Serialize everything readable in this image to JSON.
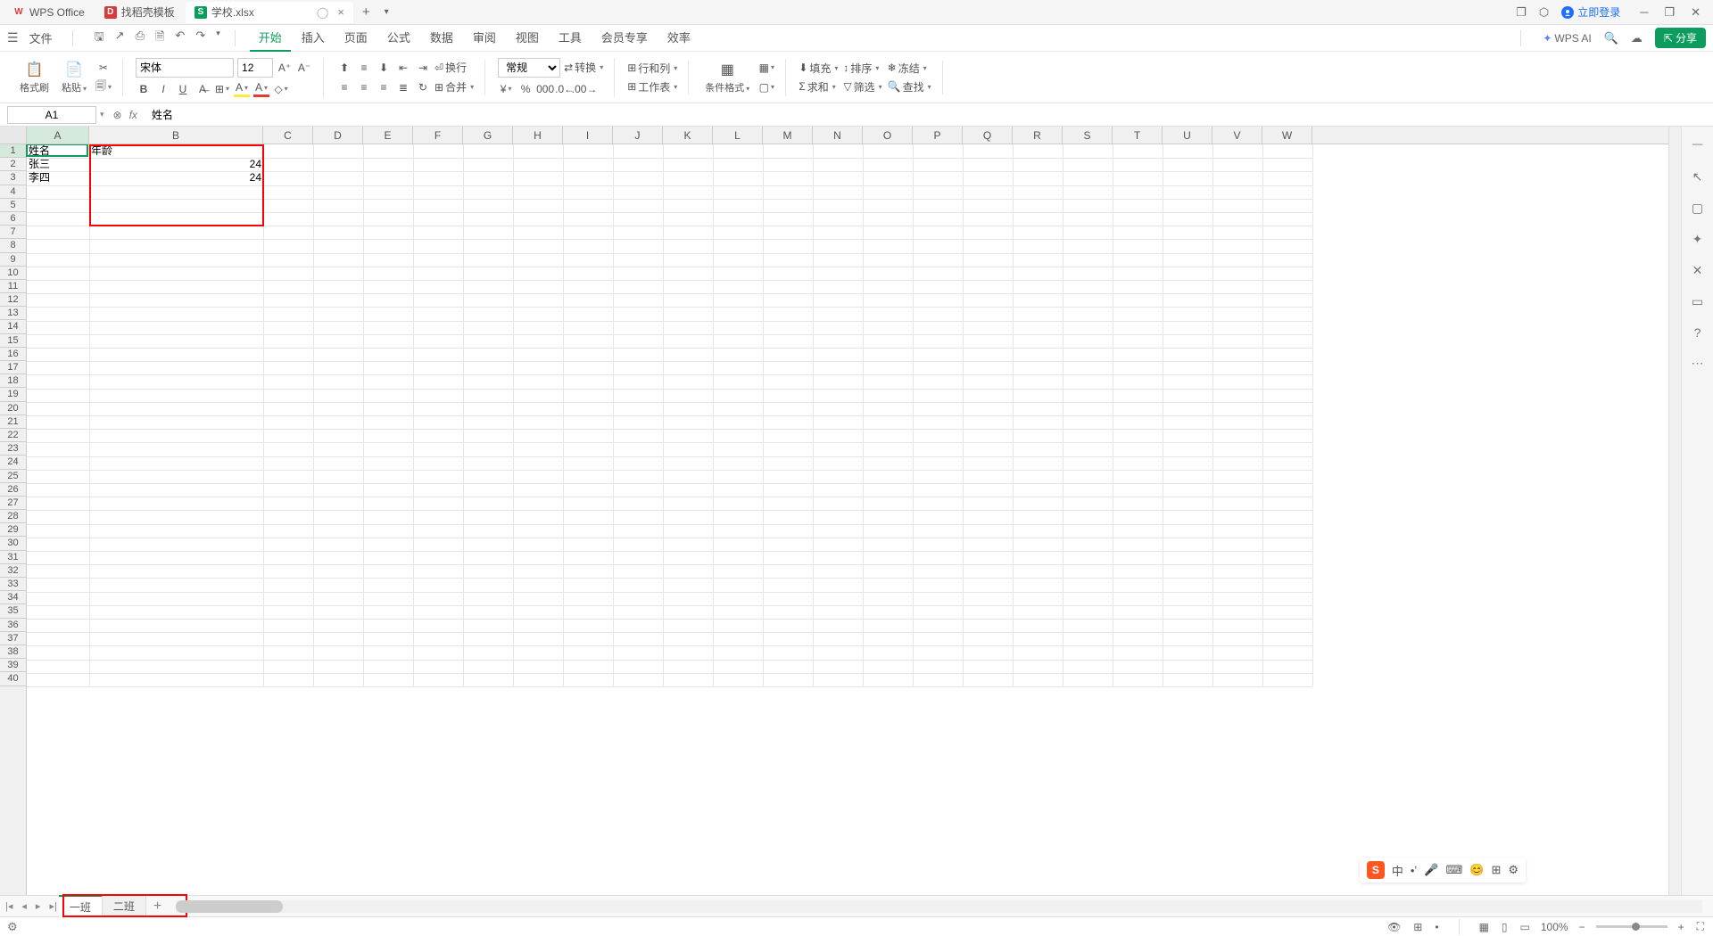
{
  "title_tabs": [
    {
      "label": "WPS Office",
      "icon": "wps"
    },
    {
      "label": "找稻壳模板",
      "icon": "doc"
    },
    {
      "label": "学校.xlsx",
      "icon": "xls",
      "active": true,
      "closable": true
    }
  ],
  "login_label": "立即登录",
  "file_label": "文件",
  "menu_tabs": [
    "开始",
    "插入",
    "页面",
    "公式",
    "数据",
    "审阅",
    "视图",
    "工具",
    "会员专享",
    "效率"
  ],
  "active_menu_tab": "开始",
  "wps_ai_label": "WPS AI",
  "share_label": "分享",
  "font_name": "宋体",
  "font_size": "12",
  "ribbon": {
    "format_painter": "格式刷",
    "paste": "粘贴",
    "normal": "常规",
    "convert": "转换",
    "wrap": "换行",
    "merge": "合并",
    "row_col": "行和列",
    "worksheet": "工作表",
    "cond_format": "条件格式",
    "fill": "填充",
    "sort": "排序",
    "freeze": "冻结",
    "sum": "求和",
    "filter": "筛选",
    "find": "查找"
  },
  "cell_ref": "A1",
  "formula_value": "姓名",
  "columns": [
    "A",
    "B",
    "C",
    "D",
    "E",
    "F",
    "G",
    "H",
    "I",
    "J",
    "K",
    "L",
    "M",
    "N",
    "O",
    "P",
    "Q",
    "R",
    "S",
    "T",
    "U",
    "V",
    "W"
  ],
  "col_widths": {
    "A": 70,
    "B": 195,
    "default": 56
  },
  "row_count": 40,
  "cells": [
    {
      "r": 1,
      "c": "A",
      "v": "姓名"
    },
    {
      "r": 1,
      "c": "B",
      "v": "年龄"
    },
    {
      "r": 2,
      "c": "A",
      "v": "张三"
    },
    {
      "r": 2,
      "c": "B",
      "v": "24",
      "align": "right"
    },
    {
      "r": 3,
      "c": "A",
      "v": "李四"
    },
    {
      "r": 3,
      "c": "B",
      "v": "24",
      "align": "right"
    }
  ],
  "selected_cell": {
    "r": 1,
    "c": "A"
  },
  "sheet_tabs": [
    "一班",
    "二班"
  ],
  "active_sheet": "一班",
  "zoom": "100%",
  "ime": {
    "lang": "中",
    "symbols": [
      "中",
      "゜",
      "●",
      "⊞",
      "⌨",
      "❖",
      "⚙"
    ]
  }
}
